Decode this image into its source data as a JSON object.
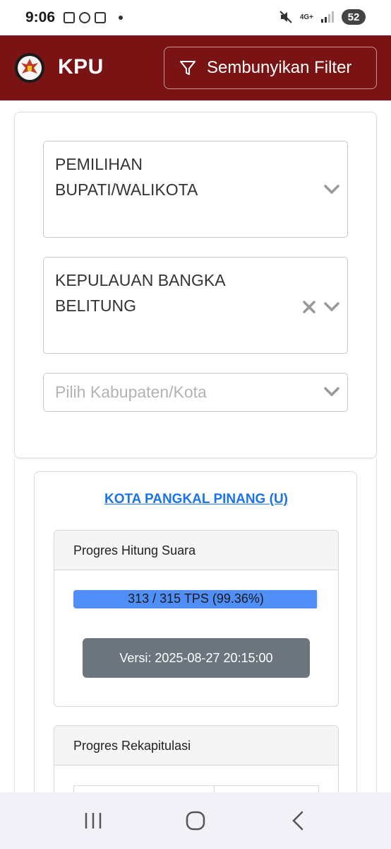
{
  "status_bar": {
    "time": "9:06",
    "network": "4G+",
    "battery": "52"
  },
  "header": {
    "brand": "KPU",
    "logo_icon": "kpu-garuda-logo",
    "filter_button_label": "Sembunyikan Filter",
    "colors": {
      "background": "#7a1414",
      "text": "#ffffff"
    }
  },
  "filters": {
    "election_type": {
      "value": "PEMILIHAN BUPATI/WALIKOTA"
    },
    "province": {
      "value": "KEPULAUAN BANGKA BELITUNG"
    },
    "regency": {
      "value": "",
      "placeholder": "Pilih Kabupaten/Kota"
    }
  },
  "result": {
    "region_link": "KOTA PANGKAL PINANG (U)",
    "vote_count_panel": {
      "title": "Progres Hitung Suara",
      "progress_text": "313 / 315 TPS (99.36%)",
      "progress_fraction": 0.9936,
      "version_label": "Versi: 2025-08-27 20:15:00"
    },
    "recap_panel": {
      "title": "Progres Rekapitulasi"
    },
    "colors": {
      "link": "#1a73e8",
      "progress": "#4f8ff7",
      "version_button": "#6c757d"
    }
  }
}
